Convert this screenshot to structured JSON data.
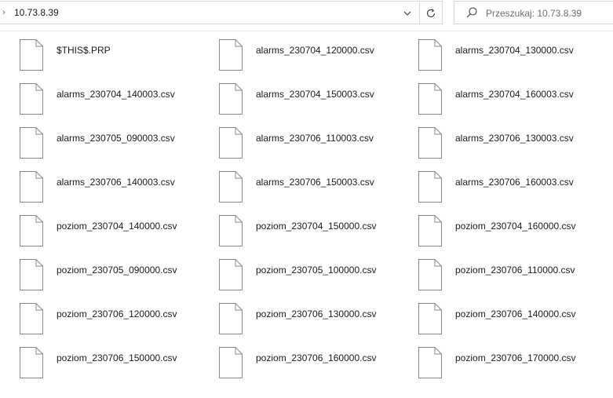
{
  "address_bar": {
    "path": "10.73.8.39"
  },
  "search": {
    "placeholder": "Przeszukaj: 10.73.8.39"
  },
  "files": [
    {
      "name": "$THIS$.PRP"
    },
    {
      "name": "alarms_230704_120000.csv"
    },
    {
      "name": "alarms_230704_130000.csv"
    },
    {
      "name": "alarms_230704_140003.csv"
    },
    {
      "name": "alarms_230704_150003.csv"
    },
    {
      "name": "alarms_230704_160003.csv"
    },
    {
      "name": "alarms_230705_090003.csv"
    },
    {
      "name": "alarms_230706_110003.csv"
    },
    {
      "name": "alarms_230706_130003.csv"
    },
    {
      "name": "alarms_230706_140003.csv"
    },
    {
      "name": "alarms_230706_150003.csv"
    },
    {
      "name": "alarms_230706_160003.csv"
    },
    {
      "name": "poziom_230704_140000.csv"
    },
    {
      "name": "poziom_230704_150000.csv"
    },
    {
      "name": "poziom_230704_160000.csv"
    },
    {
      "name": "poziom_230705_090000.csv"
    },
    {
      "name": "poziom_230705_100000.csv"
    },
    {
      "name": "poziom_230706_110000.csv"
    },
    {
      "name": "poziom_230706_120000.csv"
    },
    {
      "name": "poziom_230706_130000.csv"
    },
    {
      "name": "poziom_230706_140000.csv"
    },
    {
      "name": "poziom_230706_150000.csv"
    },
    {
      "name": "poziom_230706_160000.csv"
    },
    {
      "name": "poziom_230706_170000.csv"
    }
  ],
  "icons": {
    "file": "blank-document-icon",
    "search": "search-icon",
    "refresh": "refresh-icon",
    "dropdown": "chevron-down-icon",
    "breadcrumb": "chevron-right-icon"
  }
}
